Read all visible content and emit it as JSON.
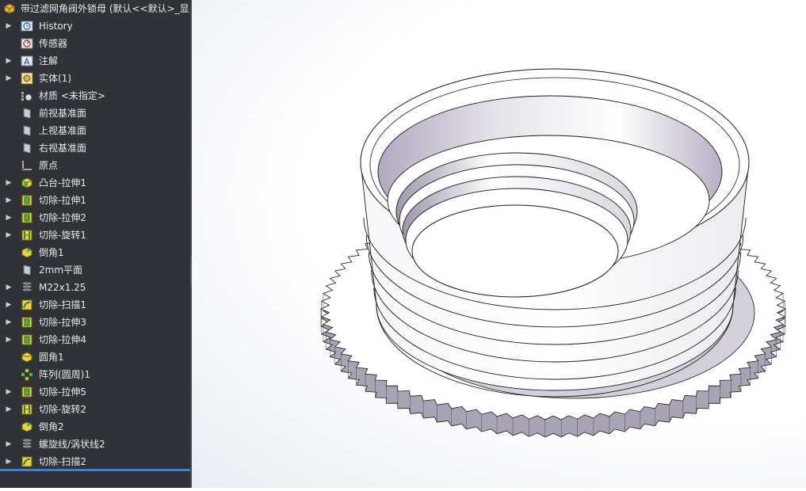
{
  "document": {
    "title": "带过滤网角阀外锁母 (默认<<默认>_显"
  },
  "feature_tree": {
    "items": [
      {
        "label": "History",
        "icon": "history-icon",
        "expandable": true
      },
      {
        "label": "传感器",
        "icon": "sensor-icon",
        "expandable": false
      },
      {
        "label": "注解",
        "icon": "annotation-icon",
        "expandable": true
      },
      {
        "label": "实体(1)",
        "icon": "solid-bodies-icon",
        "expandable": true
      },
      {
        "label": "材质 <未指定>",
        "icon": "material-icon",
        "expandable": false
      },
      {
        "label": "前视基准面",
        "icon": "plane-icon",
        "expandable": false
      },
      {
        "label": "上视基准面",
        "icon": "plane-icon",
        "expandable": false
      },
      {
        "label": "右视基准面",
        "icon": "plane-icon",
        "expandable": false
      },
      {
        "label": "原点",
        "icon": "origin-icon",
        "expandable": false
      },
      {
        "label": "凸台-拉伸1",
        "icon": "boss-extrude-icon",
        "expandable": true
      },
      {
        "label": "切除-拉伸1",
        "icon": "cut-extrude-icon",
        "expandable": true
      },
      {
        "label": "切除-拉伸2",
        "icon": "cut-extrude-icon",
        "expandable": true
      },
      {
        "label": "切除-旋转1",
        "icon": "cut-revolve-icon",
        "expandable": true
      },
      {
        "label": "倒角1",
        "icon": "chamfer-icon",
        "expandable": false
      },
      {
        "label": "2mm平面",
        "icon": "plane-icon",
        "expandable": false
      },
      {
        "label": "M22x1.25",
        "icon": "helix-icon",
        "expandable": true
      },
      {
        "label": "切除-扫描1",
        "icon": "cut-sweep-icon",
        "expandable": true
      },
      {
        "label": "切除-拉伸3",
        "icon": "cut-extrude-icon",
        "expandable": true
      },
      {
        "label": "切除-拉伸4",
        "icon": "cut-extrude-icon",
        "expandable": true
      },
      {
        "label": "圆角1",
        "icon": "fillet-icon",
        "expandable": false
      },
      {
        "label": "阵列(圆周)1",
        "icon": "circular-pattern-icon",
        "expandable": false
      },
      {
        "label": "切除-拉伸5",
        "icon": "cut-extrude-icon",
        "expandable": true
      },
      {
        "label": "切除-旋转2",
        "icon": "cut-revolve-icon",
        "expandable": true
      },
      {
        "label": "倒角2",
        "icon": "chamfer-icon",
        "expandable": false
      },
      {
        "label": "螺旋线/涡状线2",
        "icon": "helix-icon",
        "expandable": true
      },
      {
        "label": "切除-扫描2",
        "icon": "cut-sweep-icon",
        "expandable": true
      }
    ]
  },
  "model": {
    "knurl_teeth": 90,
    "colors": {
      "body": "#ffffff",
      "shadow": "#a9a4b4",
      "edge": "#1a1a1a",
      "panel_bg": "#2f3338",
      "selection": "#3d7fd1"
    }
  }
}
